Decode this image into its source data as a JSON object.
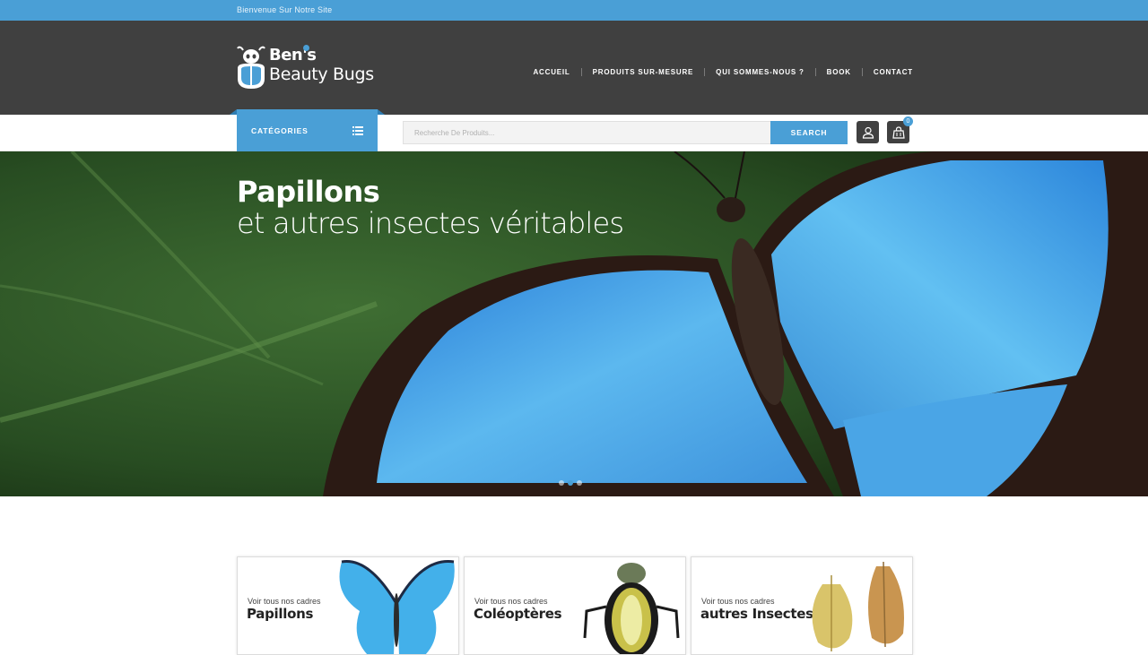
{
  "topbar": {
    "welcome": "Bienvenue Sur Notre Site"
  },
  "brand": {
    "line1": "Ben's",
    "line2": "Beauty Bugs"
  },
  "nav": {
    "items": [
      {
        "label": "ACCUEIL"
      },
      {
        "label": "PRODUITS SUR-MESURE"
      },
      {
        "label": "QUI SOMMES-NOUS ?"
      },
      {
        "label": "BOOK"
      },
      {
        "label": "CONTACT"
      }
    ]
  },
  "toolbar": {
    "categories_label": "CATÉGORIES",
    "search_placeholder": "Recherche De Produits...",
    "search_button": "SEARCH",
    "cart_count": "0"
  },
  "hero": {
    "title": "Papillons",
    "subtitle": "et autres insectes véritables",
    "slides": 3,
    "active_slide": 2
  },
  "cards": [
    {
      "sub": "Voir tous nos cadres",
      "title": "Papillons",
      "icon": "blue-butterfly-image"
    },
    {
      "sub": "Voir tous nos cadres",
      "title": "Coléoptères",
      "icon": "beetle-image"
    },
    {
      "sub": "Voir tous nos cadres",
      "title": "autres Insectes",
      "icon": "leaf-insect-image"
    }
  ],
  "colors": {
    "accent": "#4a9fd6",
    "header": "#404040",
    "topbar": "#4a9fd6"
  }
}
